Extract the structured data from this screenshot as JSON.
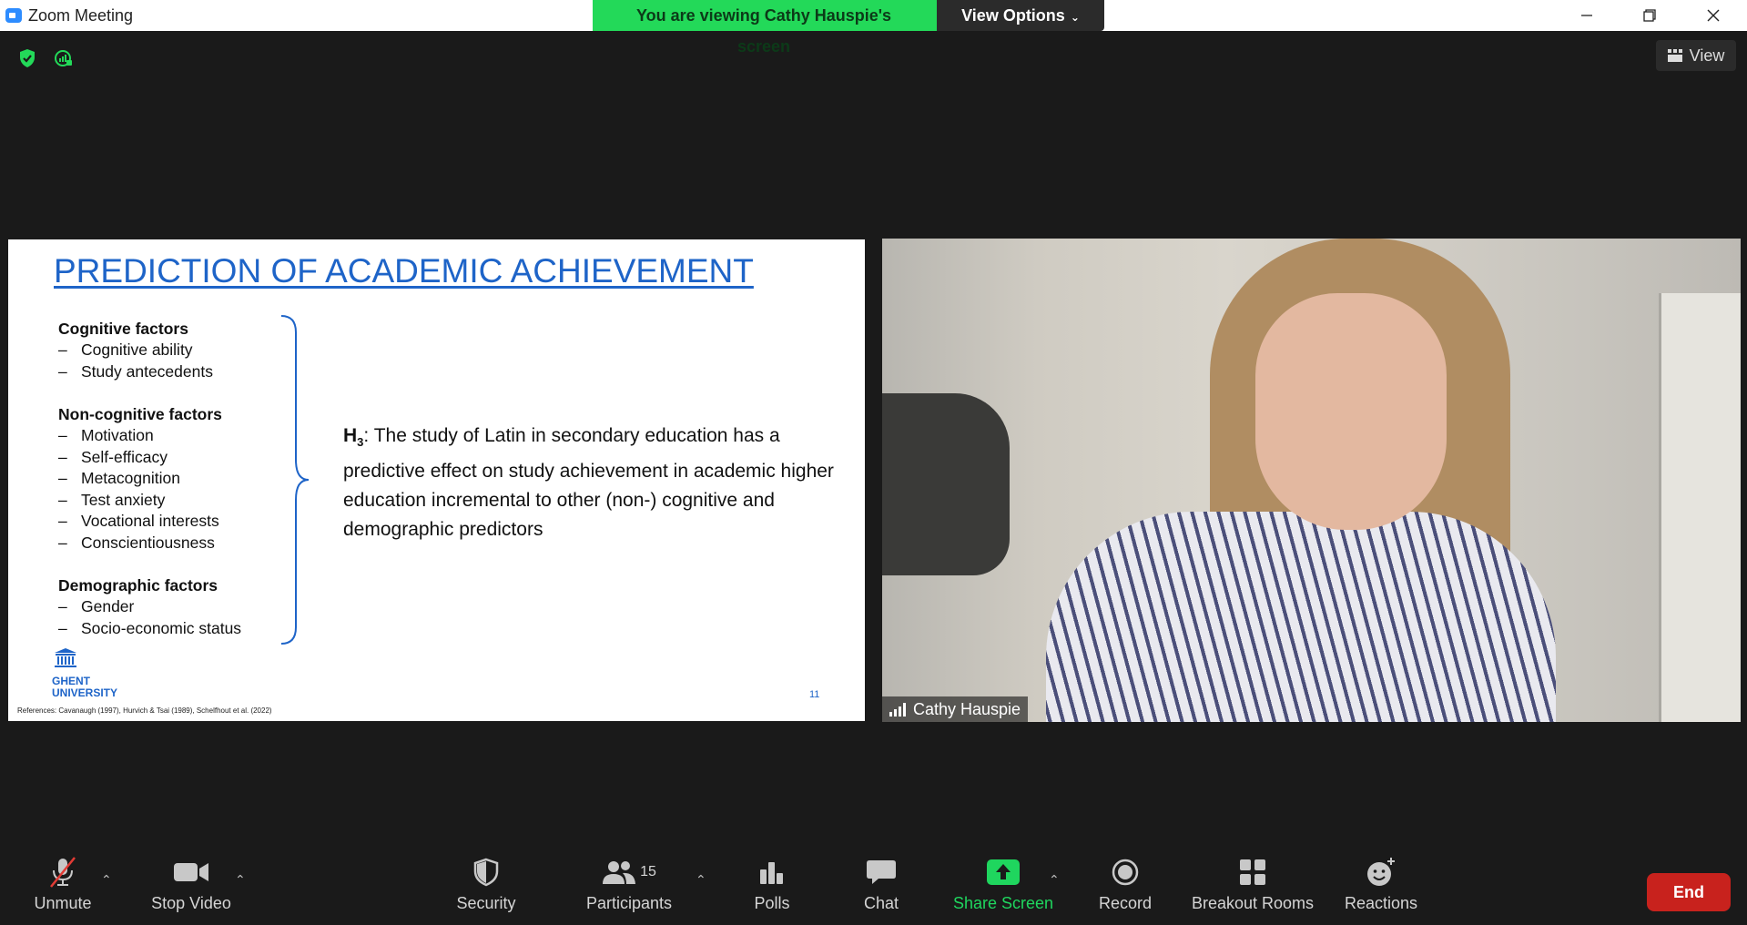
{
  "window": {
    "title": "Zoom Meeting",
    "minimize_icon": "minimize-icon",
    "restore_icon": "restore-icon",
    "close_icon": "close-icon"
  },
  "banner": {
    "viewing_text": "You are viewing Cathy Hauspie's screen",
    "view_options_label": "View Options"
  },
  "top": {
    "view_label": "View"
  },
  "slide": {
    "title": "PREDICTION OF ACADEMIC ACHIEVEMENT",
    "groups": [
      {
        "title": "Cognitive factors",
        "items": [
          "Cognitive ability",
          "Study antecedents"
        ]
      },
      {
        "title": "Non-cognitive factors",
        "items": [
          "Motivation",
          "Self-efficacy",
          "Metacognition",
          "Test anxiety",
          "Vocational interests",
          "Conscientiousness"
        ]
      },
      {
        "title": "Demographic factors",
        "items": [
          "Gender",
          "Socio-economic status"
        ]
      }
    ],
    "hypothesis_label": "H",
    "hypothesis_sub": "3",
    "hypothesis_text": ": The study of Latin in secondary education has a predictive effect on study achievement in academic higher education incremental to other (non-) cognitive and demographic predictors",
    "logo_line1": "GHENT",
    "logo_line2": "UNIVERSITY",
    "page_number": "11",
    "references": "References: Cavanaugh (1997), Hurvich & Tsai (1989), Schelfhout et al. (2022)"
  },
  "video": {
    "participant_name": "Cathy Hauspie"
  },
  "toolbar": {
    "unmute": "Unmute",
    "stop_video": "Stop Video",
    "security": "Security",
    "participants": "Participants",
    "participants_count": "15",
    "polls": "Polls",
    "chat": "Chat",
    "share_screen": "Share Screen",
    "record": "Record",
    "breakout_rooms": "Breakout Rooms",
    "reactions": "Reactions",
    "end": "End"
  },
  "colors": {
    "banner_green": "#23d959",
    "share_green": "#1fd65e",
    "end_red": "#c8221d",
    "slide_blue": "#1e64c8"
  }
}
